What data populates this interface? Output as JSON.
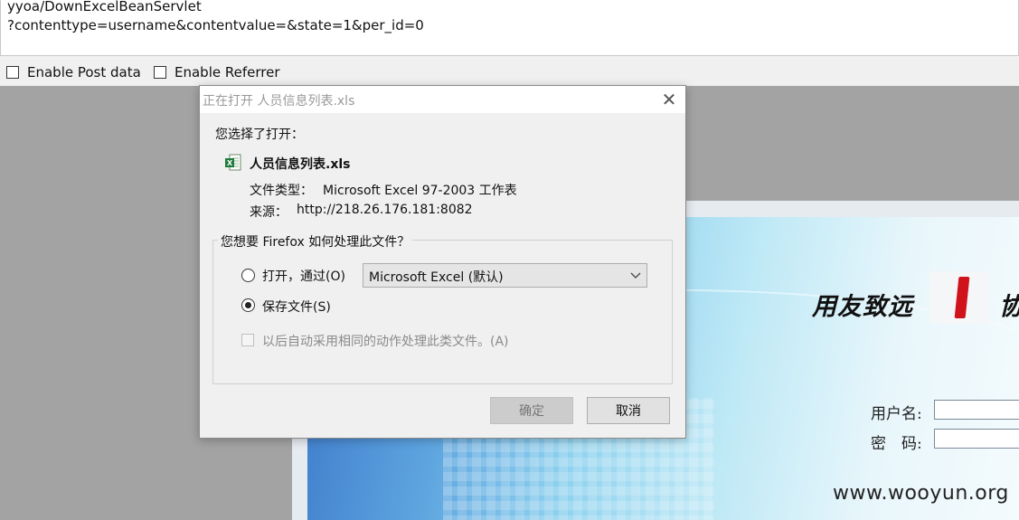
{
  "url": {
    "line1": "yyoa/DownExcelBeanServlet",
    "line2": "?contenttype=username&contentvalue=&state=1&per_id=0"
  },
  "options": {
    "post_label": "Enable Post data",
    "referrer_label": "Enable Referrer"
  },
  "dialog": {
    "title": "正在打开 人员信息列表.xls",
    "chosen_label": "您选择了打开：",
    "file_name": "人员信息列表.xls",
    "file_type_label": "文件类型：",
    "file_type_value": "Microsoft Excel 97-2003 工作表",
    "source_label": "来源：",
    "source_value": "http://218.26.176.181:8082",
    "question": "您想要 Firefox 如何处理此文件？",
    "open_with_label": "打开，通过(O)",
    "open_with_app": "Microsoft Excel (默认)",
    "save_label": "保存文件(S)",
    "save_selected": true,
    "auto_label": "以后自动采用相同的动作处理此类文件。(A)",
    "ok_label": "确定",
    "cancel_label": "取消",
    "close_icon": "close-icon",
    "file_icon": "excel-file-icon"
  },
  "background_page": {
    "brand": "用友致远",
    "brand_suffix": "协",
    "username_label": "用户名:",
    "password_label": "密　码:",
    "watermark": "www.wooyun.org"
  }
}
